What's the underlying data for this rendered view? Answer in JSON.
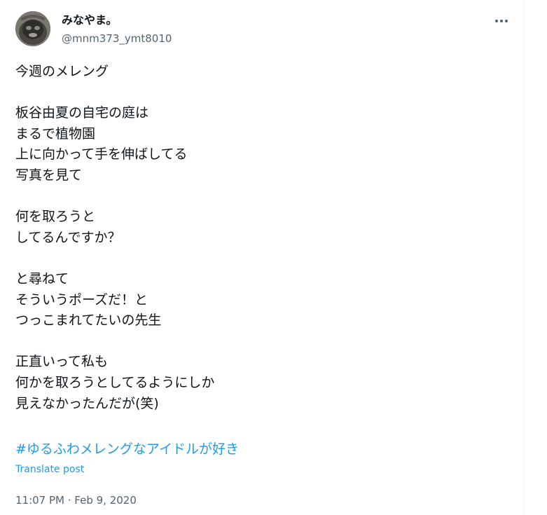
{
  "author": {
    "display_name": "みなやま。",
    "handle": "@mnm373_ymt8010"
  },
  "icons": {
    "more": "more-horizontal-icon",
    "avatar": "avatar"
  },
  "tweet": {
    "lines": [
      "今週のメレング",
      "",
      "板谷由夏の自宅の庭は",
      "まるで植物園",
      "上に向かって手を伸ばしてる",
      "写真を見て",
      "",
      "何を取ろうと",
      "してるんですか？",
      "",
      "と尋ねて",
      "そういうポーズだ！と",
      "つっこまれてたいの先生",
      "",
      "正直いって私も",
      "何かを取ろうとしてるようにしか",
      "見えなかったんだが(笑)"
    ],
    "hashtag": "#ゆるふわメレングなアイドルが好き",
    "translate_label": "Translate post",
    "timestamp": "11:07 PM · Feb 9, 2020"
  },
  "colors": {
    "link": "#1d9bf0",
    "secondary_text": "#536471",
    "primary_text": "#0f1419"
  }
}
